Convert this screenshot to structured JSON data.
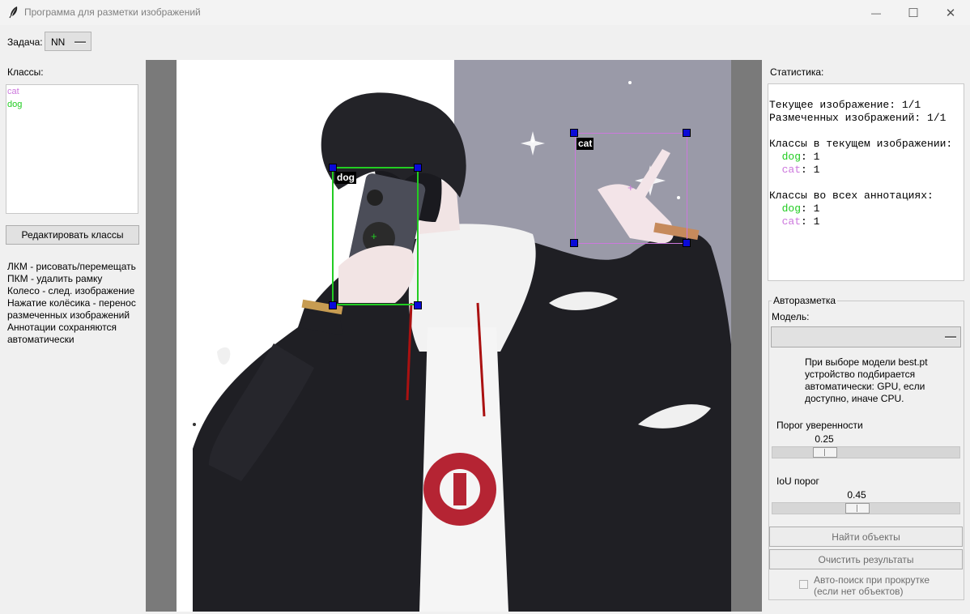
{
  "window": {
    "title": "Программа для разметки изображений",
    "minimize_glyph": "—",
    "maximize_glyph": "☐",
    "close_glyph": "✕"
  },
  "task": {
    "label": "Задача:",
    "value": "NN"
  },
  "classes": {
    "label": "Классы:",
    "items": [
      {
        "name": "cat",
        "color": "#cc77dd"
      },
      {
        "name": "dog",
        "color": "#22cc22"
      }
    ],
    "edit_button": "Редактировать классы"
  },
  "help": [
    "ЛКМ - рисовать/перемещать",
    "ПКМ - удалить рамку",
    "Колесо - след. изображение",
    "Нажатие колёсика - перенос",
    "размеченных изображений",
    "Аннотации сохраняются",
    "автоматически"
  ],
  "canvas": {
    "boxes": [
      {
        "label": "dog",
        "color": "#22cc22"
      },
      {
        "label": "cat",
        "color": "#cc77dd"
      }
    ]
  },
  "stats": {
    "label": "Статистика:",
    "current_image": "Текущее изображение: 1/1",
    "labeled_images": "Размеченных изображений: 1/1",
    "current_classes_title": "Классы в текущем изображении:",
    "current_classes": [
      {
        "name": "dog",
        "count": "1",
        "color": "#22cc22"
      },
      {
        "name": "cat",
        "count": "1",
        "color": "#cc77dd"
      }
    ],
    "all_classes_title": "Классы во всех аннотациях:",
    "all_classes": [
      {
        "name": "dog",
        "count": "1",
        "color": "#22cc22"
      },
      {
        "name": "cat",
        "count": "1",
        "color": "#cc77dd"
      }
    ]
  },
  "autolabel": {
    "title": "Авторазметка",
    "model_label": "Модель:",
    "model_value": "",
    "note": "При выборе модели best.pt устройство подбирается автоматически: GPU, если доступно, иначе CPU.",
    "confidence_label": "Порог уверенности",
    "confidence_value": "0.25",
    "confidence_fraction": 0.25,
    "iou_label": "IoU порог",
    "iou_value": "0.45",
    "iou_fraction": 0.45,
    "find_button": "Найти объекты",
    "clear_button": "Очистить результаты",
    "auto_search_label_1": "Авто-поиск при прокрутке",
    "auto_search_label_2": "(если нет объектов)",
    "auto_search_checked": false
  }
}
